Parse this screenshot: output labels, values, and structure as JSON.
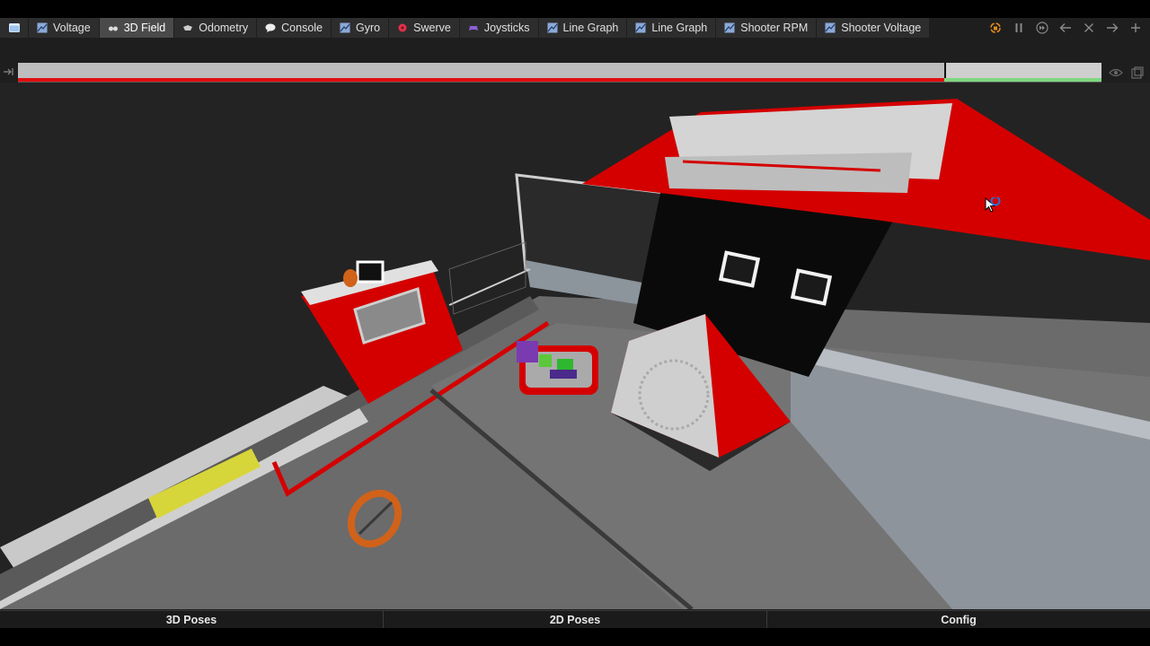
{
  "tabs": [
    {
      "label": "",
      "icon": "window-icon",
      "active": false
    },
    {
      "label": "Voltage",
      "icon": "line-graph-icon",
      "active": false
    },
    {
      "label": "3D Field",
      "icon": "glasses-icon",
      "active": true
    },
    {
      "label": "Odometry",
      "icon": "robot-icon",
      "active": false
    },
    {
      "label": "Console",
      "icon": "speech-bubble-icon",
      "active": false
    },
    {
      "label": "Gyro",
      "icon": "line-graph-icon",
      "active": false
    },
    {
      "label": "Swerve",
      "icon": "swerve-icon",
      "active": false
    },
    {
      "label": "Joysticks",
      "icon": "gamepad-icon",
      "active": false
    },
    {
      "label": "Line Graph",
      "icon": "line-graph-icon",
      "active": false
    },
    {
      "label": "Line Graph",
      "icon": "line-graph-icon",
      "active": false
    },
    {
      "label": "Shooter RPM",
      "icon": "line-graph-icon",
      "active": false
    },
    {
      "label": "Shooter Voltage",
      "icon": "line-graph-icon",
      "active": false
    }
  ],
  "controls": [
    "lock-icon",
    "pause-icon",
    "fast-forward-icon",
    "arrow-left-icon",
    "close-icon",
    "arrow-right-icon",
    "plus-icon"
  ],
  "timeline": {
    "progress": 0.855,
    "enabled_fraction": 0.855,
    "colors": {
      "disabled": "#e01010",
      "enabled": "#7fd87f"
    }
  },
  "bottom_tabs": [
    {
      "label": "3D Poses"
    },
    {
      "label": "2D Poses"
    },
    {
      "label": "Config"
    }
  ],
  "colors": {
    "accent_active_tab": "#4a4a4a",
    "alliance_red": "#d40000",
    "field_carpet": "#6b6b6b",
    "note_orange": "#d0621a"
  }
}
